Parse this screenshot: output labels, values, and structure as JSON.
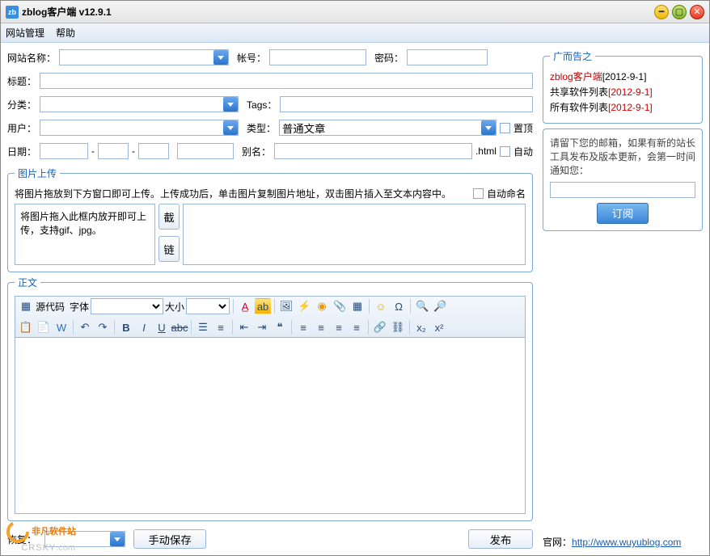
{
  "window": {
    "title": "zblog客户端 v12.9.1"
  },
  "menu": {
    "site": "网站管理",
    "help": "帮助"
  },
  "form": {
    "site_label": "网站名称：",
    "account_label": "帐号：",
    "password_label": "密码：",
    "title_label": "标题：",
    "cat_label": "分类：",
    "tags_label": "Tags：",
    "user_label": "用户：",
    "type_label": "类型：",
    "type_value": "普通文章",
    "sticky": "置顶",
    "date_label": "日期：",
    "alias_label": "别名：",
    "html_ext": ".html",
    "auto": "自动"
  },
  "upload": {
    "legend": "图片上传",
    "hint": "将图片拖放到下方窗口即可上传。上传成功后，单击图片复制图片地址，双击图片插入至文本内容中。",
    "autoname": "自动命名",
    "droptext": "将图片拖入此框内放开即可上传，支持gif、jpg。",
    "crop": "截",
    "link": "链"
  },
  "editor": {
    "legend": "正文",
    "source": "源代码",
    "font_label": "字体",
    "size_label": "大小"
  },
  "bottom": {
    "recover_label": "恢复：",
    "manual_save": "手动保存",
    "publish": "发布"
  },
  "ads": {
    "legend": "广而告之",
    "items": [
      {
        "pre": "zblog客户端",
        "date": "[2012-9-1]",
        "pre_red": true,
        "date_red": false
      },
      {
        "pre": "共享软件列表",
        "date": "[2012-9-1]",
        "pre_red": false,
        "date_red": true
      },
      {
        "pre": "所有软件列表",
        "date": "[2012-9-1]",
        "pre_red": false,
        "date_red": true
      }
    ]
  },
  "subscribe": {
    "text": "请留下您的邮箱，如果有新的站长工具发布及版本更新，会第一时间通知您：",
    "btn": "订阅"
  },
  "footer": {
    "label": "官网：",
    "url": "http://www.wuyublog.com"
  },
  "watermark": {
    "a": "非凡软件站",
    "b": "CRSKY",
    "c": ".com"
  }
}
